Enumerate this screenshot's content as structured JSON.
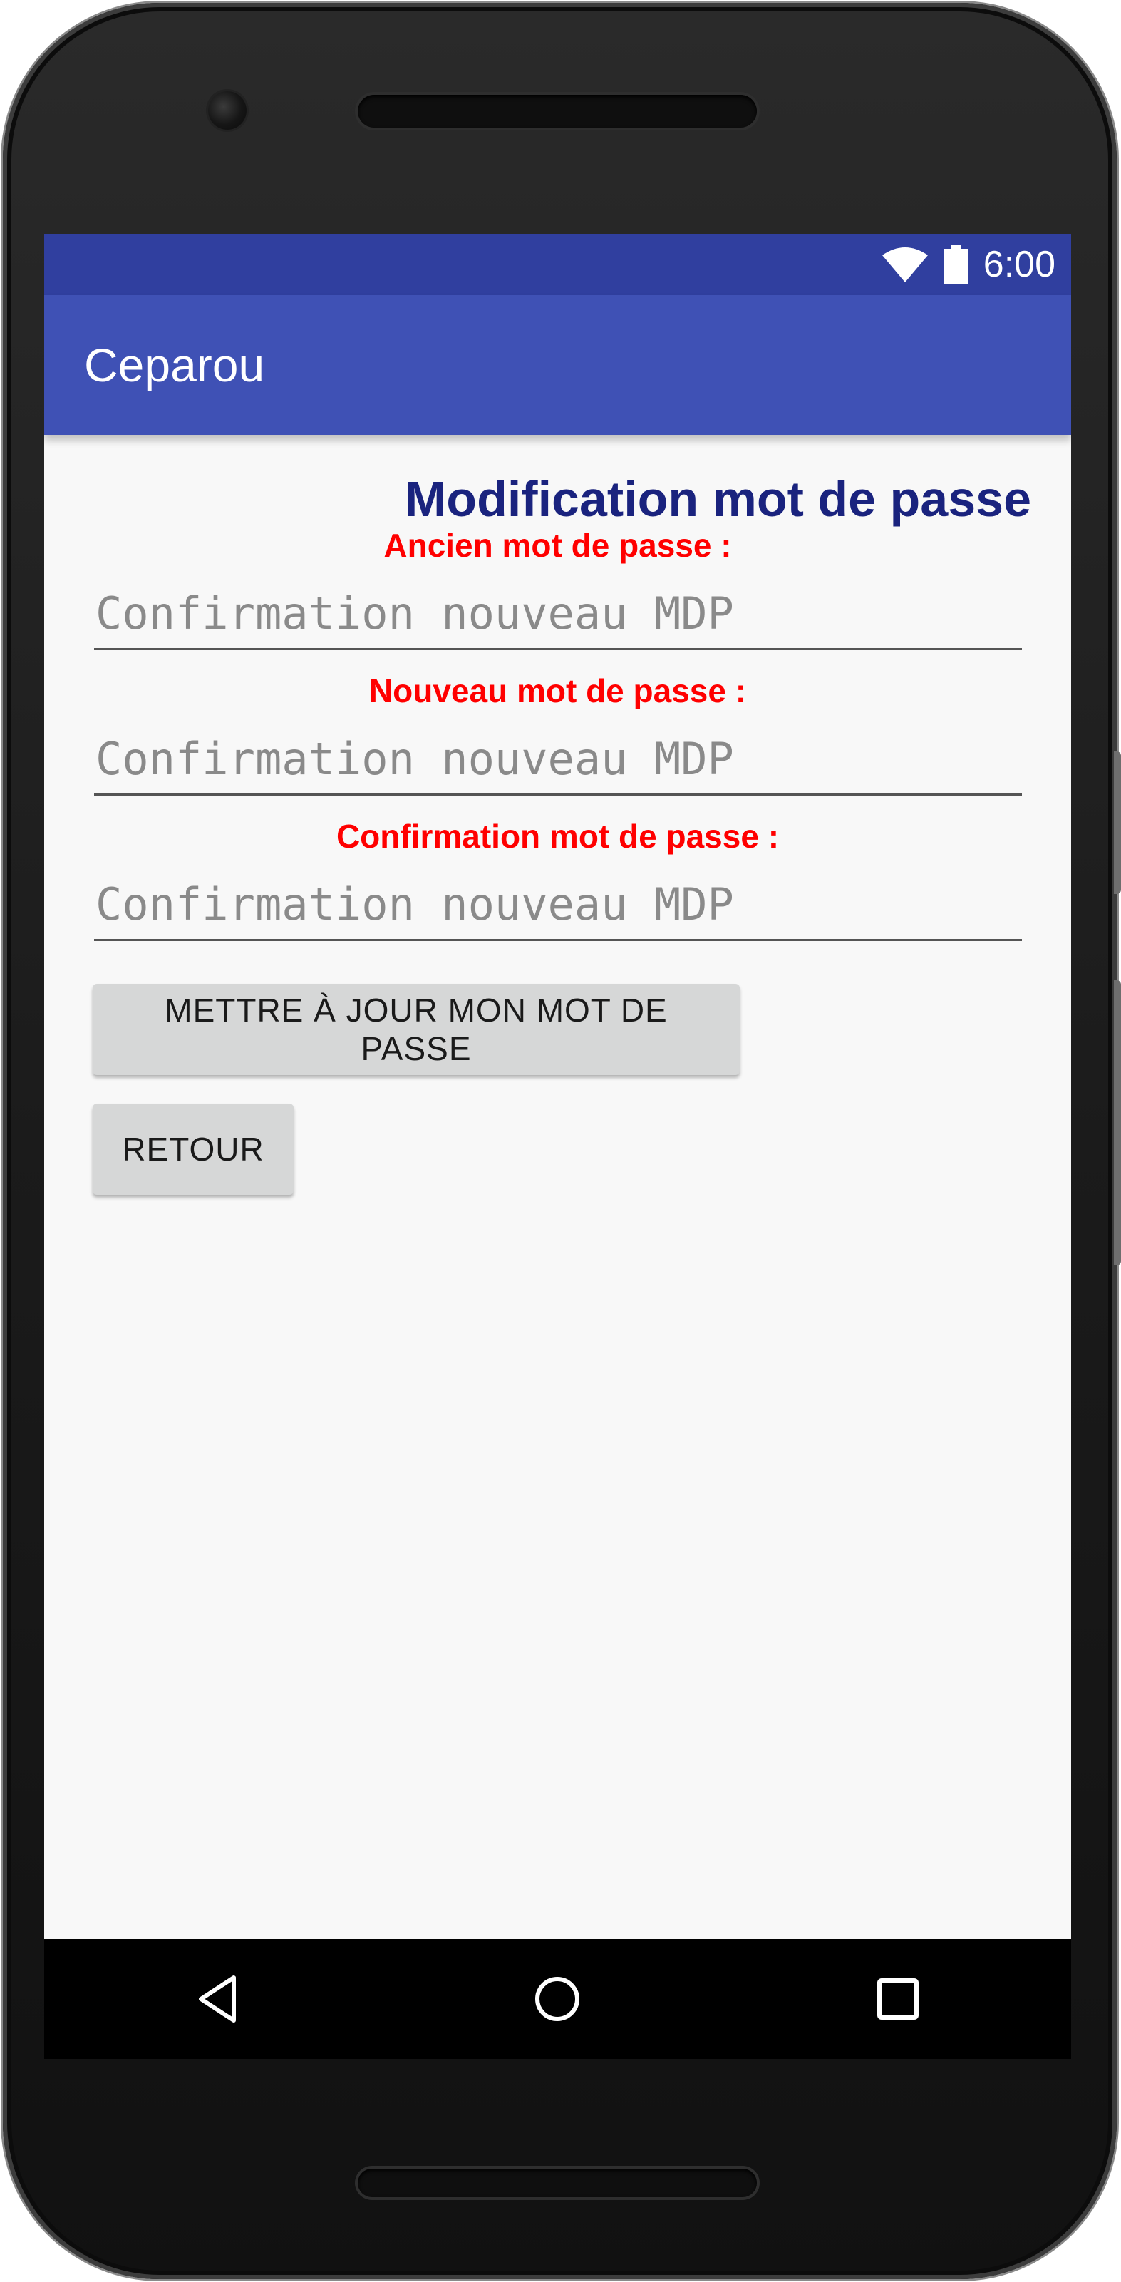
{
  "status_bar": {
    "time": "6:00",
    "icons": [
      "wifi-icon",
      "battery-icon"
    ]
  },
  "app_bar": {
    "title": "Ceparou"
  },
  "page": {
    "title": "Modification mot de passe",
    "fields": [
      {
        "label": "Ancien mot de passe :",
        "placeholder": "Confirmation nouveau MDP",
        "value": ""
      },
      {
        "label": "Nouveau mot de passe :",
        "placeholder": "Confirmation nouveau MDP",
        "value": ""
      },
      {
        "label": "Confirmation mot de passe :",
        "placeholder": "Confirmation nouveau MDP",
        "value": ""
      }
    ],
    "buttons": {
      "update": "METTRE À JOUR MON MOT DE PASSE",
      "back": "RETOUR"
    }
  },
  "nav_bar": {
    "icons": [
      "back-triangle-icon",
      "home-circle-icon",
      "recents-square-icon"
    ]
  },
  "colors": {
    "status_bar": "#303f9f",
    "app_bar": "#3f51b5",
    "title": "#1a237e",
    "label": "#ff0000",
    "background": "#f8f8f8",
    "button": "#d6d7d7"
  }
}
